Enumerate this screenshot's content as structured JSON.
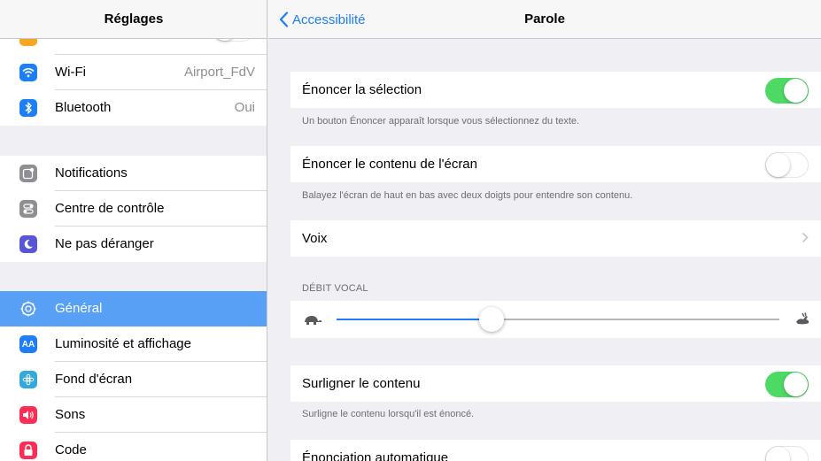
{
  "sidebar": {
    "title": "Réglages",
    "items": [
      {
        "id": "partial",
        "label": "",
        "icon": "airplane-icon",
        "color": "#f5a623"
      },
      {
        "id": "wifi",
        "label": "Wi-Fi",
        "value": "Airport_FdV",
        "icon": "wifi-icon",
        "color": "#1d7ff5"
      },
      {
        "id": "bluetooth",
        "label": "Bluetooth",
        "value": "Oui",
        "icon": "bluetooth-icon",
        "color": "#1d7ff5"
      },
      {
        "id": "notifications",
        "label": "Notifications",
        "icon": "notifications-icon",
        "color": "#8e8e93"
      },
      {
        "id": "control",
        "label": "Centre de contrôle",
        "icon": "control-center-icon",
        "color": "#8e8e93"
      },
      {
        "id": "dnd",
        "label": "Ne pas déranger",
        "icon": "moon-icon",
        "color": "#5856d6"
      },
      {
        "id": "general",
        "label": "Général",
        "icon": "gear-icon",
        "color": "#8e8e93",
        "selected": true
      },
      {
        "id": "display",
        "label": "Luminosité et affichage",
        "icon": "display-icon",
        "color": "#1d7ff5",
        "icon_text": "AA"
      },
      {
        "id": "wallpaper",
        "label": "Fond d'écran",
        "icon": "wallpaper-icon",
        "color": "#34aadc"
      },
      {
        "id": "sounds",
        "label": "Sons",
        "icon": "speaker-icon",
        "color": "#ff2d55"
      },
      {
        "id": "code",
        "label": "Code",
        "icon": "lock-icon",
        "color": "#ff2d55"
      }
    ]
  },
  "detail": {
    "back_label": "Accessibilité",
    "title": "Parole",
    "speak_selection": {
      "label": "Énoncer la sélection",
      "on": true,
      "footer": "Un bouton Énoncer apparaît lorsque vous sélectionnez du texte."
    },
    "speak_screen": {
      "label": "Énoncer le contenu de l'écran",
      "on": false,
      "footer": "Balayez l'écran de haut en bas avec deux doigts pour entendre son contenu."
    },
    "voices": {
      "label": "Voix"
    },
    "speaking_rate": {
      "header": "DÉBIT VOCAL",
      "value": 0.35
    },
    "highlight": {
      "label": "Surligner le contenu",
      "on": true,
      "footer": "Surligne le contenu lorsqu'il est énoncé."
    },
    "auto_speech": {
      "label": "Énonciation automatique",
      "on": false
    }
  },
  "colors": {
    "accent": "#1d7ff5",
    "toggle_on": "#4cd964",
    "selected_row": "#57a0f6"
  }
}
